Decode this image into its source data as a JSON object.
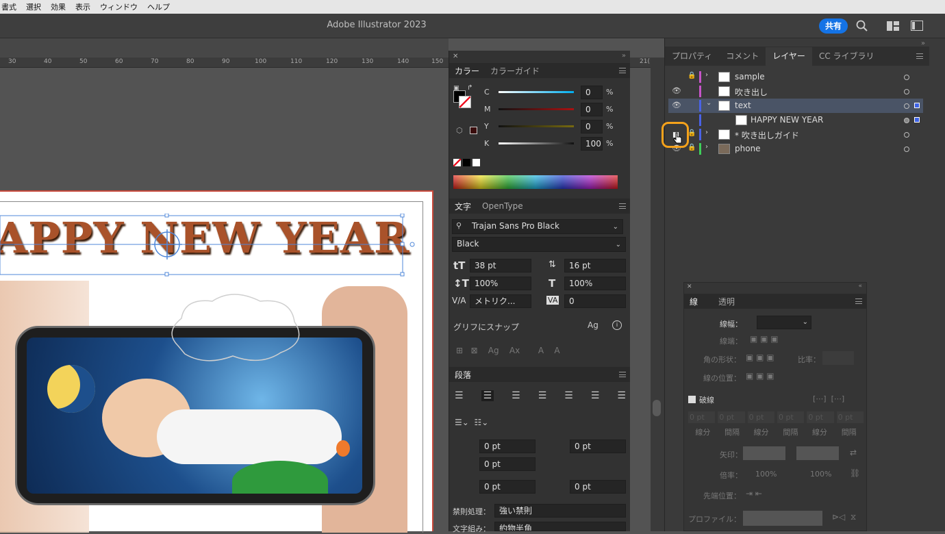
{
  "menu": [
    "書式",
    "選択",
    "効果",
    "表示",
    "ウィンドウ",
    "ヘルプ"
  ],
  "app_title": "Adobe Illustrator 2023",
  "share_label": "共有",
  "ruler_ticks": [
    "30",
    "40",
    "50",
    "60",
    "70",
    "80",
    "90",
    "100",
    "110",
    "120",
    "130",
    "140",
    "150",
    "21("
  ],
  "artwork": {
    "headline": "APPY NEW YEAR"
  },
  "color_panel": {
    "tabs": [
      "カラー",
      "カラーガイド"
    ],
    "channels": [
      {
        "label": "C",
        "value": "0",
        "unit": "%"
      },
      {
        "label": "M",
        "value": "0",
        "unit": "%"
      },
      {
        "label": "Y",
        "value": "0",
        "unit": "%"
      },
      {
        "label": "K",
        "value": "100",
        "unit": "%"
      }
    ]
  },
  "type_panel": {
    "tabs": [
      "文字",
      "OpenType"
    ],
    "font_family": "Trajan Sans Pro Black",
    "font_style": "Black",
    "size": "38 pt",
    "leading": "16 pt",
    "vscale": "100%",
    "hscale": "100%",
    "kerning": "メトリク...",
    "tracking": "0",
    "snap_label": "グリフにスナップ"
  },
  "para_panel": {
    "title": "段落",
    "indent_left": "0 pt",
    "indent_right": "0 pt",
    "first_indent": "0 pt",
    "space_before": "0 pt",
    "space_after": "0 pt",
    "kinsoku_label": "禁則処理：",
    "kinsoku_value": "強い禁則",
    "mojikumi_label": "文字組み：",
    "mojikumi_value": "約物半角"
  },
  "right_tabs": [
    "プロパティ",
    "コメント",
    "レイヤー",
    "CC ライブラリ"
  ],
  "layers": [
    {
      "name": "sample",
      "color": "#c654c9"
    },
    {
      "name": "吹き出し",
      "color": "#c654c9"
    },
    {
      "name": "text",
      "color": "#4a63e6"
    },
    {
      "name": "HAPPY NEW YEAR",
      "color": "#4a63e6"
    },
    {
      "name": "* 吹き出しガイド",
      "color": "#4a63e6"
    },
    {
      "name": "phone",
      "color": "#3fcf5a"
    }
  ],
  "stroke_panel": {
    "tabs": [
      "線",
      "透明"
    ],
    "width_label": "線幅：",
    "cap_label": "線端：",
    "corner_label": "角の形状：",
    "ratio_label": "比率：",
    "align_label": "線の位置：",
    "dashed_label": "破線",
    "dash_cols": [
      "線分",
      "間隔",
      "線分",
      "間隔",
      "線分",
      "間隔"
    ],
    "dash_placeholder": "0 pt",
    "arrow_label": "矢印：",
    "scale_label": "倍率：",
    "scale_value": "100%",
    "tip_label": "先端位置：",
    "profile_label": "プロファイル："
  }
}
